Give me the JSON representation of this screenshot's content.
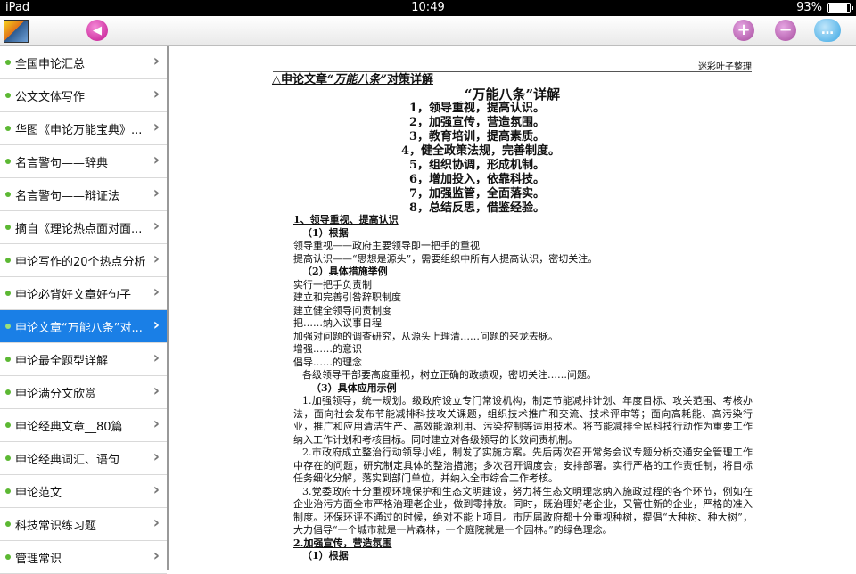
{
  "status_bar": {
    "device": "iPad",
    "time": "10:49",
    "battery": "93%",
    "battery_level": 0.93
  },
  "toolbar": {
    "back_glyph": "◀",
    "plus_glyph": "+",
    "minus_glyph": "−",
    "chat_glyph": "…"
  },
  "sidebar": {
    "items": [
      {
        "label": "全国申论汇总"
      },
      {
        "label": "公文文体写作"
      },
      {
        "label": "华图《申论万能宝典》..."
      },
      {
        "label": "名言警句——辞典"
      },
      {
        "label": "名言警句——辩证法"
      },
      {
        "label": "摘自《理论热点面对面..."
      },
      {
        "label": "申论写作的20个热点分析"
      },
      {
        "label": "申论必背好文章好句子"
      },
      {
        "label": "申论文章“万能八条”对..."
      },
      {
        "label": "申论最全题型详解"
      },
      {
        "label": "申论满分文欣赏"
      },
      {
        "label": "申论经典文章__80篇"
      },
      {
        "label": "申论经典词汇、语句"
      },
      {
        "label": "申论范文"
      },
      {
        "label": "科技常识练习题"
      },
      {
        "label": "管理常识"
      }
    ],
    "chevron": "›"
  },
  "document": {
    "credit": "迷彩叶子整理",
    "title_prefix": "△申论文章",
    "title_quote": "“万能八条”",
    "title_suffix": "对策详解",
    "heading": "“万能八条”详解",
    "points": [
      "1，领导重视，提高认识。",
      "2，加强宣传，营造氛围。",
      "3，教育培训，提高素质。",
      "4，健全政策法规，完善制度。",
      "5，组织协调，形成机制。",
      "6，增加投入，依靠科技。",
      "7，加强监管，全面落实。",
      "8，总结反思，借鉴经验。"
    ],
    "sec1": "1、领导重视、提高认识",
    "sec1_sub1": "（1）根据",
    "l1": "领导重视——政府主要领导即一把手的重视",
    "l2": "提高认识——“思想是源头”，需要组织中所有人提高认识，密切关注。",
    "sec1_sub2": "（2）具体措施举例",
    "l3": "实行一把手负责制",
    "l4": "建立和完善引咎辞职制度",
    "l5": "建立健全领导问责制度",
    "l6": "把……纳入议事日程",
    "l7": "加强对问题的调查研究，从源头上理清……问题的来龙去脉。",
    "l8": "增强……的意识",
    "l9": "倡导……的理念",
    "l10": "各级领导干部要高度重视，树立正确的政绩观，密切关注……问题。",
    "sec1_sub3": "（3）具体应用示例",
    "p1": "1.加强领导，统一规划。级政府设立专门常设机构，制定节能减排计划、年度目标、攻关范围、考核办法，面向社会发布节能减排科技攻关课题，组织技术推广和交流、技术评审等；面向高耗能、高污染行业，推广和应用清洁生产、高效能源利用、污染控制等适用技术。将节能减排全民科技行动作为重要工作纳入工作计划和考核目标。同时建立对各级领导的长效问责机制。",
    "p2": "2.市政府成立整治行动领导小组，制发了实施方案。先后两次召开常务会议专题分析交通安全管理工作中存在的问题，研究制定具体的整治措施；多次召开调度会，安排部署。实行严格的工作责任制，将目标任务细化分解，落实到部门单位，并纳入全市综合工作考核。",
    "p3": "3.党委政府十分重视环境保护和生态文明建设，努力将生态文明理念纳入施政过程的各个环节，例如在企业治污方面全市严格治理老企业，做到零排放。同时，既治理好老企业，又管住新的企业，严格的准入制度。环保环评不通过的时候，绝对不能上项目。市历届政府都十分重视种树，提倡“大种树、种大树”，大力倡导“一个城市就是一片森林，一个庭院就是一个园林。”的绿色理念。",
    "sec2": "2.加强宣传，营造氛围",
    "sec2_sub1": "（1）根据"
  }
}
